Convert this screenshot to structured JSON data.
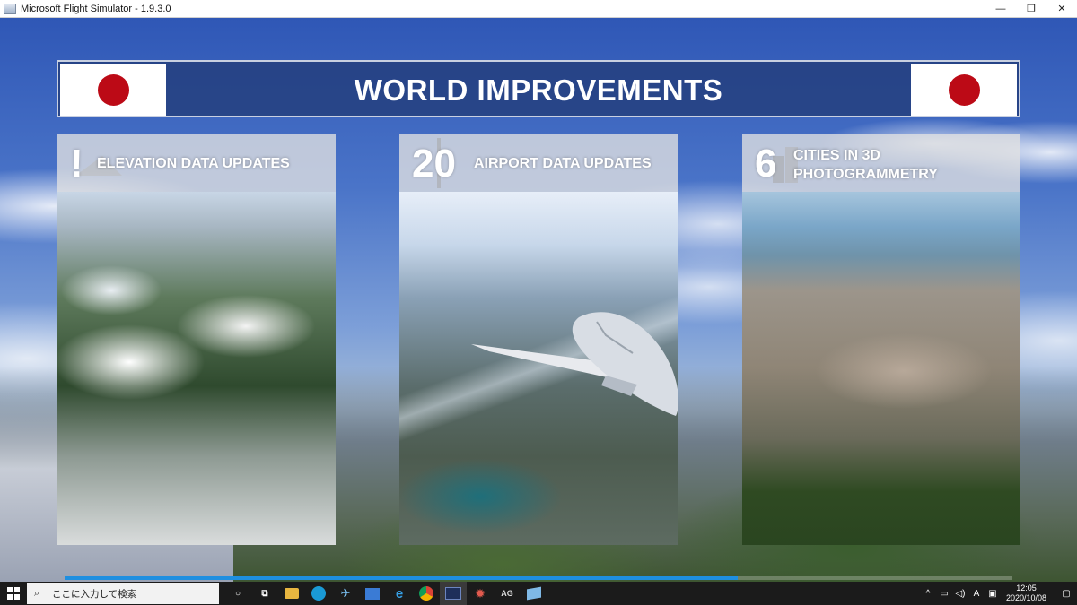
{
  "window": {
    "title": "Microsoft Flight Simulator - 1.9.3.0",
    "controls": {
      "minimize": "—",
      "maximize": "❐",
      "close": "✕"
    }
  },
  "banner": {
    "title": "WORLD IMPROVEMENTS",
    "flag_color": "#bc0a16"
  },
  "cards": [
    {
      "number": "!",
      "label": "ELEVATION DATA UPDATES"
    },
    {
      "number": "20",
      "label": "AIRPORT DATA UPDATES"
    },
    {
      "number": "6",
      "label_line1": "CITIES IN 3D",
      "label_line2": "PHOTOGRAMMETRY"
    }
  ],
  "progress": {
    "percent": 71
  },
  "taskbar": {
    "search_placeholder": "ここに入力して検索",
    "apps": [
      {
        "name": "cortana-icon",
        "glyph": "○"
      },
      {
        "name": "task-view-icon",
        "glyph": "⧉"
      },
      {
        "name": "file-explorer-icon",
        "glyph": ""
      },
      {
        "name": "edge-icon",
        "glyph": ""
      },
      {
        "name": "flight-app-icon",
        "glyph": "✈"
      },
      {
        "name": "store-icon",
        "glyph": ""
      },
      {
        "name": "ie-icon",
        "glyph": "e"
      },
      {
        "name": "chrome-icon",
        "glyph": ""
      },
      {
        "name": "flight-simulator-icon",
        "glyph": ""
      },
      {
        "name": "gear-app-icon",
        "glyph": "✹"
      },
      {
        "name": "ag-icon",
        "glyph": "AG"
      },
      {
        "name": "app-cube-icon",
        "glyph": ""
      }
    ],
    "tray": {
      "ime": "A",
      "time": "12:05",
      "date": "2020/10/08"
    }
  }
}
